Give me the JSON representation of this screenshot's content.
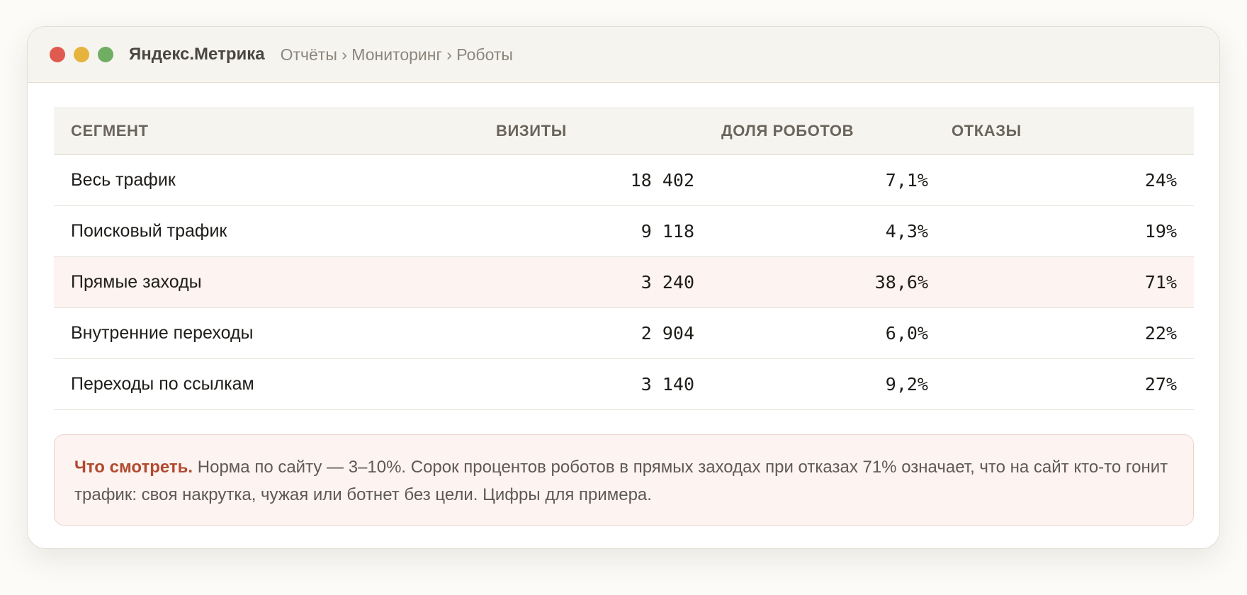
{
  "window": {
    "app_name": "Яндекс.Метрика",
    "breadcrumb": "Отчёты › Мониторинг › Роботы"
  },
  "table": {
    "headers": [
      "СЕГМЕНТ",
      "ВИЗИТЫ",
      "ДОЛЯ РОБОТОВ",
      "ОТКАЗЫ"
    ],
    "rows": [
      {
        "segment": "Весь трафик",
        "visits": "18 402",
        "bot_share": "7,1%",
        "bounce": "24%"
      },
      {
        "segment": "Поисковый трафик",
        "visits": "9 118",
        "bot_share": "4,3%",
        "bounce": "19%"
      },
      {
        "segment": "Прямые заходы",
        "visits": "3 240",
        "bot_share": "38,6%",
        "bounce": "71%"
      },
      {
        "segment": "Внутренние переходы",
        "visits": "2 904",
        "bot_share": "6,0%",
        "bounce": "22%"
      },
      {
        "segment": "Переходы по ссылкам",
        "visits": "3 140",
        "bot_share": "9,2%",
        "bounce": "27%"
      }
    ]
  },
  "note": {
    "lead": "Что смотреть.",
    "text": "Норма по сайту — 3–10%. Сорок процентов роботов в прямых заходах при отказах 71% означает, что на сайт кто-то гонит трафик: своя накрутка, чужая или ботнет без цели. Цифры для примера."
  },
  "colors": {
    "close": "#e05a4f",
    "minimize": "#e6b33c",
    "maximize": "#6fae63",
    "accent": "#b04a2f",
    "highlight_row": "#fdf3f0"
  }
}
